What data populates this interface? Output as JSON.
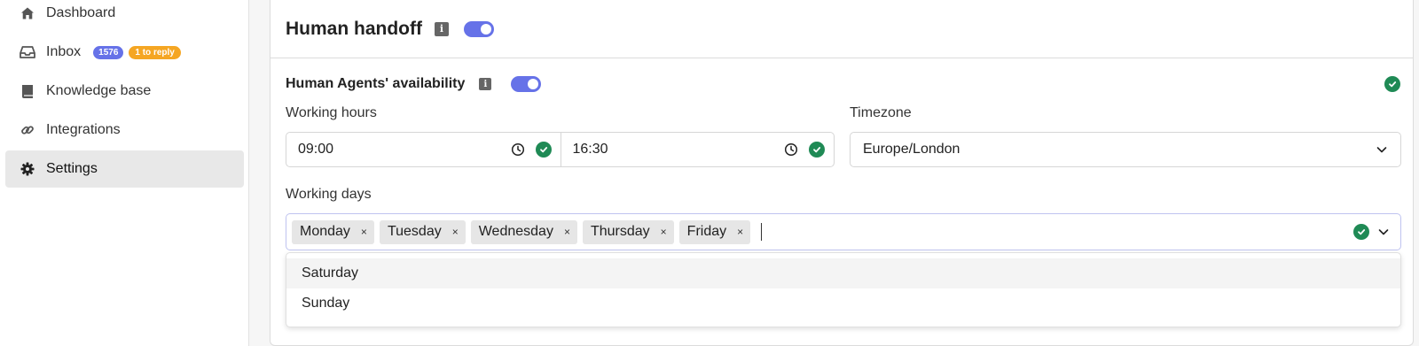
{
  "sidebar": {
    "items": [
      {
        "label": "Dashboard",
        "icon": "home-icon"
      },
      {
        "label": "Inbox",
        "icon": "inbox-icon",
        "count": "1576",
        "reply": "1 to reply"
      },
      {
        "label": "Knowledge base",
        "icon": "book-icon"
      },
      {
        "label": "Integrations",
        "icon": "link-icon"
      },
      {
        "label": "Settings",
        "icon": "gear-icon",
        "active": true
      }
    ]
  },
  "handoff": {
    "title": "Human handoff",
    "enabled": true
  },
  "availability": {
    "title": "Human Agents' availability",
    "enabled": true,
    "working_hours_label": "Working hours",
    "start_time": "09:00",
    "end_time": "16:30",
    "timezone_label": "Timezone",
    "timezone": "Europe/London",
    "working_days_label": "Working days",
    "selected_days": [
      "Monday",
      "Tuesday",
      "Wednesday",
      "Thursday",
      "Friday"
    ],
    "remove_symbol": "×",
    "options": [
      "Saturday",
      "Sunday"
    ]
  },
  "colors": {
    "accent": "#6672e8",
    "success": "#1f8a55",
    "reply_badge": "#f5a623"
  }
}
